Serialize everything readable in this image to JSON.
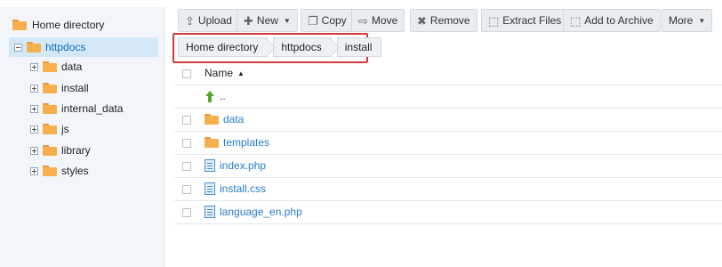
{
  "sidebar": {
    "root_label": "Home directory",
    "selected_label": "httpdocs",
    "children": [
      {
        "label": "data"
      },
      {
        "label": "install"
      },
      {
        "label": "internal_data"
      },
      {
        "label": "js"
      },
      {
        "label": "library"
      },
      {
        "label": "styles"
      }
    ]
  },
  "toolbar": {
    "upload": "Upload",
    "new": "New",
    "copy": "Copy",
    "move": "Move",
    "remove": "Remove",
    "extract": "Extract Files",
    "archive": "Add to Archive",
    "more": "More"
  },
  "breadcrumb": [
    "Home directory",
    "httpdocs",
    "install"
  ],
  "table": {
    "name_header": "Name",
    "up_label": "..",
    "rows": [
      {
        "name": "data",
        "type": "folder"
      },
      {
        "name": "templates",
        "type": "folder"
      },
      {
        "name": "index.php",
        "type": "file"
      },
      {
        "name": "install.css",
        "type": "file"
      },
      {
        "name": "language_en.php",
        "type": "file"
      }
    ]
  },
  "colors": {
    "accent_link": "#2a7cc7",
    "highlight_border": "#d33a3a",
    "folder": "#f5b04d",
    "selected_bg": "#d5e8f7"
  }
}
